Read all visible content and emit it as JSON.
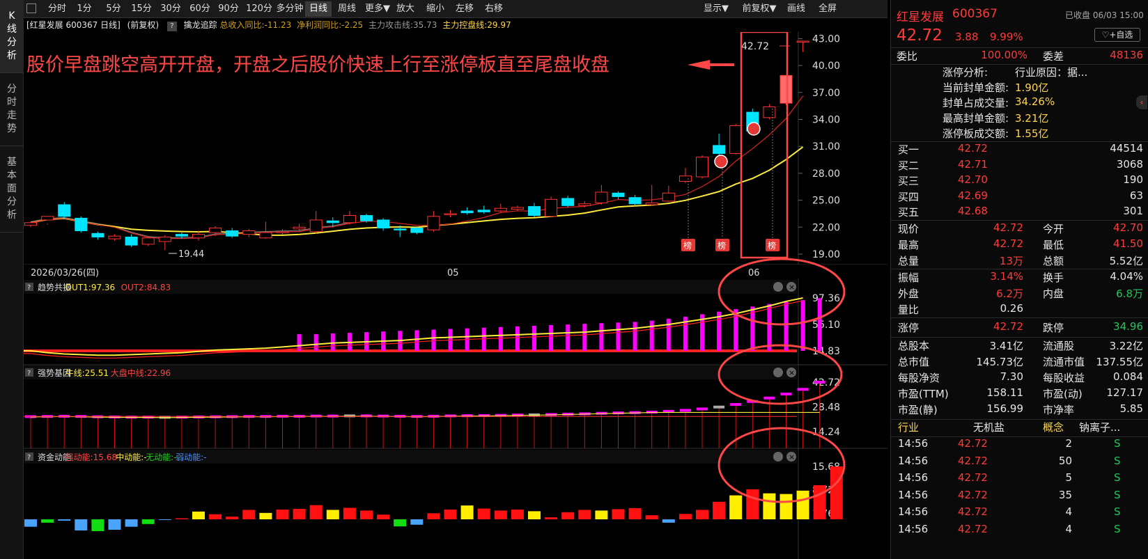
{
  "toolbar": {
    "items": [
      "分时",
      "1分",
      "5分",
      "15分",
      "30分",
      "60分",
      "90分",
      "120分",
      "多分钟",
      "日线",
      "周线",
      "更多▼",
      "放大",
      "缩小",
      "左移",
      "右移"
    ],
    "active": "日线",
    "right_items": [
      "显示▼",
      "前复权▼",
      "画线",
      "全屏"
    ]
  },
  "left_tabs": [
    "K线分析",
    "分时走势",
    "基本面分析"
  ],
  "info_line": {
    "name": "[红星发展 600367 日线]",
    "fq": "(前复权)",
    "indicator": "擒龙追踪",
    "rev": "总收入同比:-11.23",
    "profit": "净利润同比:-2.25",
    "attack": "主力攻击线:35.73",
    "control": "主力控盘线:29.97"
  },
  "annotation": "股价早盘跳空高开开盘，开盘之后股价快速上行至涨停板直至尾盘收盘",
  "main_axis": [
    "43.00",
    "40.00",
    "37.00",
    "34.00",
    "31.00",
    "28.00",
    "25.00",
    "22.00",
    "19.00"
  ],
  "last_price_label": "42.72",
  "low_label": "19.44",
  "date_labels": {
    "left": "2026/03/26(四)",
    "mid": "05",
    "right": "06"
  },
  "bang_label": "榜",
  "panels": {
    "p1": {
      "name": "趋势共振",
      "v1": "OUT1:97.36",
      "v2": "OUT2:84.83",
      "axis": [
        "97.36",
        "56.10",
        "14.83"
      ]
    },
    "p2": {
      "name": "强势基因",
      "v1": "牛线:25.51",
      "v2": "大盘中线:22.96",
      "axis": [
        "42.72",
        "28.48",
        "14.24"
      ]
    },
    "p3": {
      "name": "资金动能",
      "v1": "强动能:15.68",
      "v2": "中动能:-",
      "v3": "无动能:-",
      "v4": "弱动能:-",
      "axis": [
        "15.68",
        "8.72",
        "1.76"
      ]
    }
  },
  "colors": {
    "up": "#ff3333",
    "down": "#00e5ff",
    "ma_yellow": "#ffeb3b",
    "magenta": "#ff00ff",
    "accent_red": "#ff4747"
  },
  "stock": {
    "name": "红星发展",
    "code": "600367",
    "status": "已收盘 06/03 15:00",
    "price": "42.72",
    "change": "3.88",
    "pct": "9.99%",
    "watch": "♡+自选"
  },
  "ratio": {
    "label1": "委比",
    "val1": "100.00%",
    "label2": "委差",
    "val2": "48136"
  },
  "limit_analysis": [
    [
      "涨停分析:",
      "行业原因：据..."
    ],
    [
      "当前封单金额:",
      "1.90亿"
    ],
    [
      "封单占成交量:",
      "34.26%"
    ],
    [
      "最高封单金额:",
      "3.21亿"
    ],
    [
      "涨停板成交额:",
      "1.55亿"
    ]
  ],
  "bids": [
    [
      "买一",
      "42.72",
      "44514"
    ],
    [
      "买二",
      "42.71",
      "3068"
    ],
    [
      "买三",
      "42.70",
      "190"
    ],
    [
      "买四",
      "42.69",
      "63"
    ],
    [
      "买五",
      "42.68",
      "301"
    ]
  ],
  "quote": [
    [
      "现价",
      "42.72",
      "今开",
      "42.70"
    ],
    [
      "最高",
      "42.72",
      "最低",
      "41.50"
    ],
    [
      "总量",
      "13万",
      "总额",
      "5.52亿"
    ]
  ],
  "quote2": [
    [
      "振幅",
      "3.14%",
      "换手",
      "4.04%"
    ],
    [
      "外盘",
      "6.2万",
      "内盘",
      "6.8万"
    ],
    [
      "量比",
      "0.26",
      "",
      ""
    ]
  ],
  "limit": [
    "涨停",
    "42.72",
    "跌停",
    "34.96"
  ],
  "fund": [
    [
      "总股本",
      "3.41亿",
      "流通股",
      "3.22亿"
    ],
    [
      "总市值",
      "145.73亿",
      "流通市值",
      "137.55亿"
    ],
    [
      "每股净资",
      "7.30",
      "每股收益",
      "0.084"
    ],
    [
      "市盈(TTM)",
      "158.11",
      "市盈(动)",
      "127.17"
    ],
    [
      "市盈(静)",
      "156.99",
      "市净率",
      "5.85"
    ]
  ],
  "industry": [
    "行业",
    "无机盐",
    "概念",
    "钠离子..."
  ],
  "ticks": [
    [
      "14:56",
      "42.72",
      "2",
      "S"
    ],
    [
      "14:56",
      "42.72",
      "50",
      "S"
    ],
    [
      "14:56",
      "42.72",
      "5",
      "S"
    ],
    [
      "14:56",
      "42.72",
      "35",
      "S"
    ],
    [
      "14:56",
      "42.72",
      "4",
      "S"
    ],
    [
      "14:56",
      "42.72",
      "4",
      "S"
    ]
  ],
  "chart_data": {
    "type": "candlestick",
    "title": "红星发展 600367 日线",
    "y_range": [
      19,
      43
    ],
    "candles": [
      [
        22.2,
        22.5,
        22.0,
        22.6
      ],
      [
        22.8,
        23.2,
        22.4,
        22.3
      ],
      [
        24.5,
        23.2,
        24.8,
        22.9
      ],
      [
        23.0,
        21.6,
        23.2,
        21.4
      ],
      [
        21.3,
        20.9,
        21.5,
        20.6
      ],
      [
        20.7,
        21.0,
        21.2,
        20.5
      ],
      [
        20.9,
        20.0,
        21.2,
        19.8
      ],
      [
        20.1,
        20.8,
        21.0,
        19.9
      ],
      [
        20.4,
        20.9,
        21.1,
        19.44
      ],
      [
        21.2,
        21.0,
        21.4,
        20.7
      ],
      [
        20.8,
        21.2,
        21.6,
        20.5
      ],
      [
        21.4,
        21.9,
        22.1,
        21.0
      ],
      [
        21.6,
        21.0,
        21.9,
        20.8
      ],
      [
        21.2,
        21.6,
        21.8,
        20.9
      ],
      [
        20.8,
        21.4,
        22.6,
        20.7
      ],
      [
        21.4,
        21.5,
        21.8,
        21.2
      ],
      [
        21.8,
        22.0,
        22.4,
        21.6
      ],
      [
        21.5,
        22.8,
        23.8,
        21.3
      ],
      [
        22.7,
        22.5,
        23.1,
        22.0
      ],
      [
        22.5,
        23.3,
        23.8,
        22.3
      ],
      [
        23.3,
        22.7,
        23.5,
        22.5
      ],
      [
        22.8,
        21.9,
        23.0,
        21.6
      ],
      [
        21.8,
        21.7,
        22.2,
        20.9
      ],
      [
        21.9,
        21.4,
        22.0,
        21.2
      ],
      [
        21.7,
        23.2,
        23.8,
        21.5
      ],
      [
        23.4,
        23.5,
        23.9,
        23.1
      ],
      [
        23.8,
        23.6,
        24.2,
        23.4
      ],
      [
        23.9,
        23.7,
        24.4,
        23.5
      ],
      [
        23.8,
        24.1,
        24.6,
        23.6
      ],
      [
        24.0,
        24.2,
        24.4,
        23.8
      ],
      [
        24.3,
        23.3,
        24.7,
        23.1
      ],
      [
        23.2,
        25.1,
        25.4,
        23.1
      ],
      [
        25.2,
        24.4,
        25.5,
        24.2
      ],
      [
        24.4,
        24.6,
        24.9,
        24.2
      ],
      [
        24.7,
        25.9,
        26.7,
        24.5
      ],
      [
        25.8,
        25.4,
        26.0,
        25.1
      ],
      [
        25.3,
        24.6,
        25.6,
        24.3
      ],
      [
        24.5,
        24.7,
        26.7,
        24.4
      ],
      [
        24.9,
        25.8,
        26.6,
        24.8
      ],
      [
        27.1,
        27.7,
        28.6,
        26.9
      ],
      [
        27.6,
        29.8,
        30.0,
        27.4
      ],
      [
        31.1,
        30.2,
        32.4,
        29.8
      ],
      [
        30.2,
        33.3,
        33.5,
        30.1
      ],
      [
        34.8,
        32.7,
        35.2,
        32.3
      ],
      [
        34.2,
        35.4,
        35.7,
        34.0
      ],
      [
        35.8,
        38.9,
        38.9,
        35.6
      ],
      [
        42.7,
        42.72,
        42.72,
        41.5
      ]
    ],
    "series": [
      {
        "name": "主力攻击线",
        "last": 35.73
      },
      {
        "name": "主力控盘线",
        "last": 29.97
      }
    ],
    "trend_bars": [
      5,
      10,
      16,
      20,
      24,
      26,
      28,
      30,
      32,
      34,
      36,
      38,
      39,
      40,
      41,
      41,
      42,
      43,
      44,
      45,
      46,
      47,
      48,
      49,
      50,
      51,
      52,
      53,
      54,
      55,
      56,
      57,
      58,
      59,
      60,
      62,
      65,
      68,
      72,
      76,
      80,
      84,
      88,
      91,
      94,
      97
    ],
    "trend_line": [
      14.83,
      15,
      12,
      10,
      9,
      8,
      8,
      9,
      10,
      11,
      12,
      14,
      16,
      17,
      18,
      19,
      21,
      23,
      25,
      27,
      28,
      29,
      30,
      31,
      33,
      35,
      36,
      37,
      38,
      39,
      40,
      41,
      42,
      43,
      44,
      46,
      48,
      50,
      53,
      56,
      60,
      64,
      68,
      73,
      79,
      85,
      92,
      97.36
    ],
    "gene_bars": [
      22.9,
      23.0,
      23.1,
      23.0,
      22.8,
      22.7,
      22.6,
      22.6,
      22.5,
      22.6,
      22.7,
      22.8,
      22.9,
      23.0,
      23.0,
      23.1,
      23.1,
      23.2,
      23.2,
      23.3,
      23.3,
      23.2,
      23.1,
      23.0,
      23.1,
      23.3,
      23.4,
      23.5,
      23.6,
      23.8,
      23.9,
      24.1,
      24.3,
      24.5,
      24.8,
      25.0,
      25.2,
      25.5,
      25.9,
      26.5,
      27.3,
      28.4,
      29.9,
      31.6,
      33.6,
      35.9,
      38.6,
      42.72
    ],
    "gene_line": [
      {
        "name": "牛线",
        "last": 25.51
      },
      {
        "name": "大盘中线",
        "last": 22.96
      }
    ],
    "fund_bars": [
      -2.2,
      -1.0,
      -0.4,
      -3.3,
      -3.5,
      -3.1,
      -2.2,
      -1.4,
      -0.2,
      0.3,
      2.3,
      1.5,
      0.8,
      2.8,
      1.9,
      2.9,
      3.1,
      4.2,
      2.8,
      3.4,
      2.6,
      1.4,
      -2.1,
      -1.6,
      1.8,
      2.9,
      4.1,
      3.2,
      2.6,
      2.9,
      2.4,
      0.6,
      2.1,
      2.8,
      2.6,
      3.0,
      3.3,
      1.2,
      -1.0,
      1.6,
      2.8,
      5.2,
      7.1,
      8.9,
      7.7,
      7.5,
      8.5,
      10.1,
      15.68
    ]
  }
}
